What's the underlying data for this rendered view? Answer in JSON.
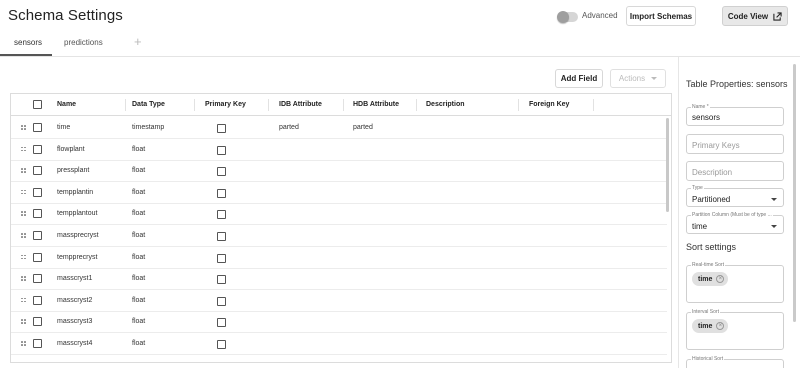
{
  "header": {
    "title": "Schema Settings",
    "advanced_label": "Advanced",
    "advanced_on": false,
    "import_label": "Import Schemas",
    "code_view_label": "Code View"
  },
  "tabs": [
    {
      "label": "sensors",
      "active": true
    },
    {
      "label": "predictions",
      "active": false
    }
  ],
  "add_tab_symbol": "+",
  "toolbar": {
    "add_field_label": "Add Field",
    "actions_label": "Actions"
  },
  "table": {
    "columns": [
      "Name",
      "Data Type",
      "Primary Key",
      "IDB Attribute",
      "HDB Attribute",
      "Description",
      "Foreign Key"
    ],
    "rows": [
      {
        "name": "time",
        "type": "timestamp",
        "idb": "parted",
        "hdb": "parted"
      },
      {
        "name": "flowplant",
        "type": "float",
        "idb": "",
        "hdb": ""
      },
      {
        "name": "pressplant",
        "type": "float",
        "idb": "",
        "hdb": ""
      },
      {
        "name": "tempplantin",
        "type": "float",
        "idb": "",
        "hdb": ""
      },
      {
        "name": "tempplantout",
        "type": "float",
        "idb": "",
        "hdb": ""
      },
      {
        "name": "massprecryst",
        "type": "float",
        "idb": "",
        "hdb": ""
      },
      {
        "name": "tempprecryst",
        "type": "float",
        "idb": "",
        "hdb": ""
      },
      {
        "name": "masscryst1",
        "type": "float",
        "idb": "",
        "hdb": ""
      },
      {
        "name": "masscryst2",
        "type": "float",
        "idb": "",
        "hdb": ""
      },
      {
        "name": "masscryst3",
        "type": "float",
        "idb": "",
        "hdb": ""
      },
      {
        "name": "masscryst4",
        "type": "float",
        "idb": "",
        "hdb": ""
      }
    ]
  },
  "panel": {
    "title": "Table Properties: sensors",
    "name_label": "Name *",
    "name_value": "sensors",
    "primary_keys_placeholder": "Primary Keys",
    "description_placeholder": "Description",
    "type_label": "Type",
    "type_value": "Partitioned",
    "partition_label": "Partition Column (Must be of type ...",
    "partition_value": "time",
    "sort_title": "Sort settings",
    "realtime_sort_label": "Real-time Sort",
    "realtime_chip": "time",
    "interval_sort_label": "Interval Sort",
    "interval_chip": "time",
    "historical_sort_label": "Historical Sort"
  }
}
